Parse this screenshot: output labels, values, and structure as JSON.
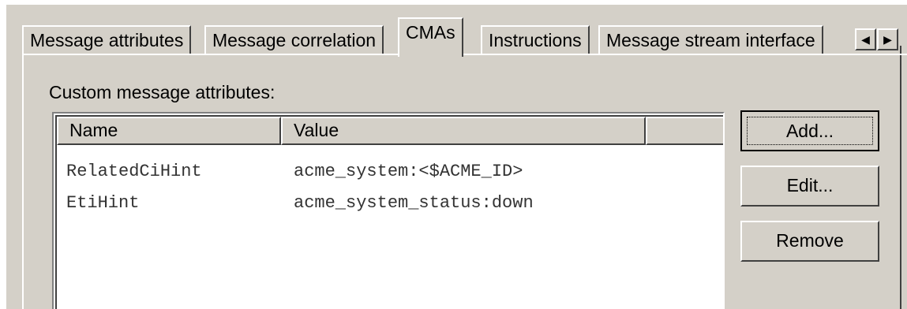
{
  "tabs": [
    {
      "label": "Message attributes",
      "active": false
    },
    {
      "label": "Message correlation",
      "active": false
    },
    {
      "label": "CMAs",
      "active": true
    },
    {
      "label": "Instructions",
      "active": false
    },
    {
      "label": "Message stream interface",
      "active": false
    }
  ],
  "tab_scroll": {
    "left_icon": "arrow-left-icon",
    "right_icon": "arrow-right-icon",
    "left_glyph": "◀",
    "right_glyph": "▶"
  },
  "section_label": "Custom message attributes:",
  "table": {
    "columns": [
      "Name",
      "Value",
      ""
    ],
    "rows": [
      {
        "name": "RelatedCiHint",
        "value": "acme_system:<$ACME_ID>"
      },
      {
        "name": "EtiHint",
        "value": "acme_system_status:down"
      }
    ]
  },
  "buttons": {
    "add": "Add...",
    "edit": "Edit...",
    "remove": "Remove"
  },
  "colors": {
    "dialog_bg": "#d4d0c8",
    "list_bg": "#ffffff"
  }
}
